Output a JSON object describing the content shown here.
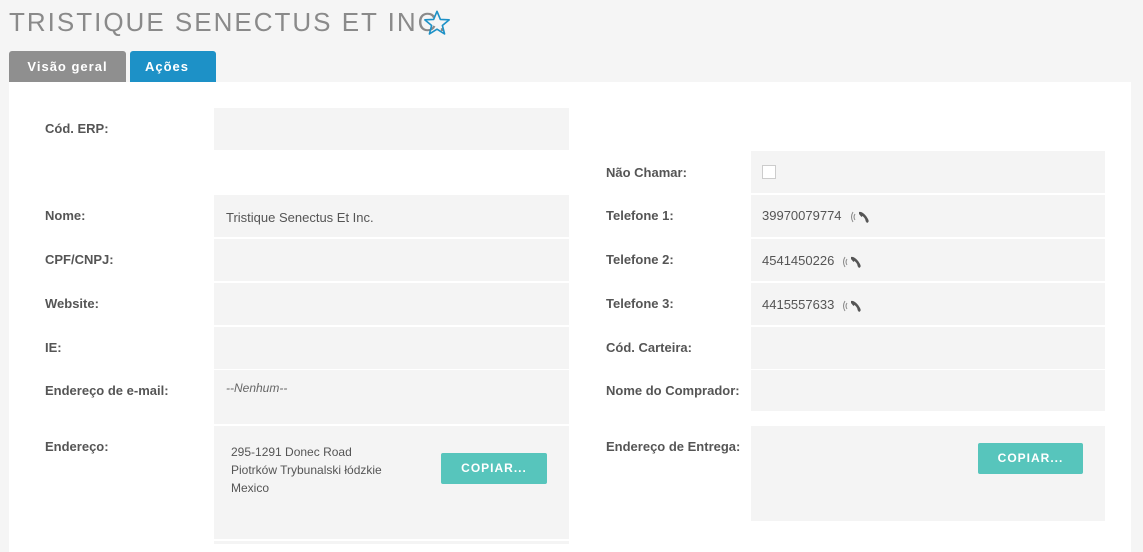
{
  "header": {
    "title": "TRISTIQUE SENECTUS ET INC."
  },
  "tabs": {
    "overview": "Visão geral",
    "actions": "Ações"
  },
  "left": {
    "erp_label": "Cód. ERP:",
    "erp_value": "",
    "name_label": "Nome:",
    "name_value": "Tristique Senectus Et Inc.",
    "cpf_label": "CPF/CNPJ:",
    "cpf_value": "",
    "website_label": "Website:",
    "website_value": "",
    "ie_label": "IE:",
    "ie_value": "",
    "email_label": "Endereço de e-mail:",
    "email_value": "--Nenhum--",
    "address_label": "Endereço:",
    "address_lines": [
      "295-1291 Donec Road",
      "Piotrków Trybunalski łódzkie",
      "Mexico"
    ],
    "copy_label": "COPIAR..."
  },
  "right": {
    "dnc_label": "Não Chamar:",
    "phone1_label": "Telefone 1:",
    "phone1_value": "39970079774",
    "phone2_label": "Telefone 2:",
    "phone2_value": "4541450226",
    "phone3_label": "Telefone 3:",
    "phone3_value": "4415557633",
    "wallet_label": "Cód. Carteira:",
    "wallet_value": "",
    "buyer_label": "Nome do Comprador:",
    "buyer_value": "",
    "shipping_label": "Endereço de Entrega:",
    "copy_label": "COPIAR..."
  },
  "colors": {
    "accent": "#1d91c7",
    "copy_button": "#57c5bc",
    "tab_gray": "#8f8f8f"
  },
  "icons": [
    "star-icon",
    "phone-icon",
    "caret-down-icon"
  ]
}
